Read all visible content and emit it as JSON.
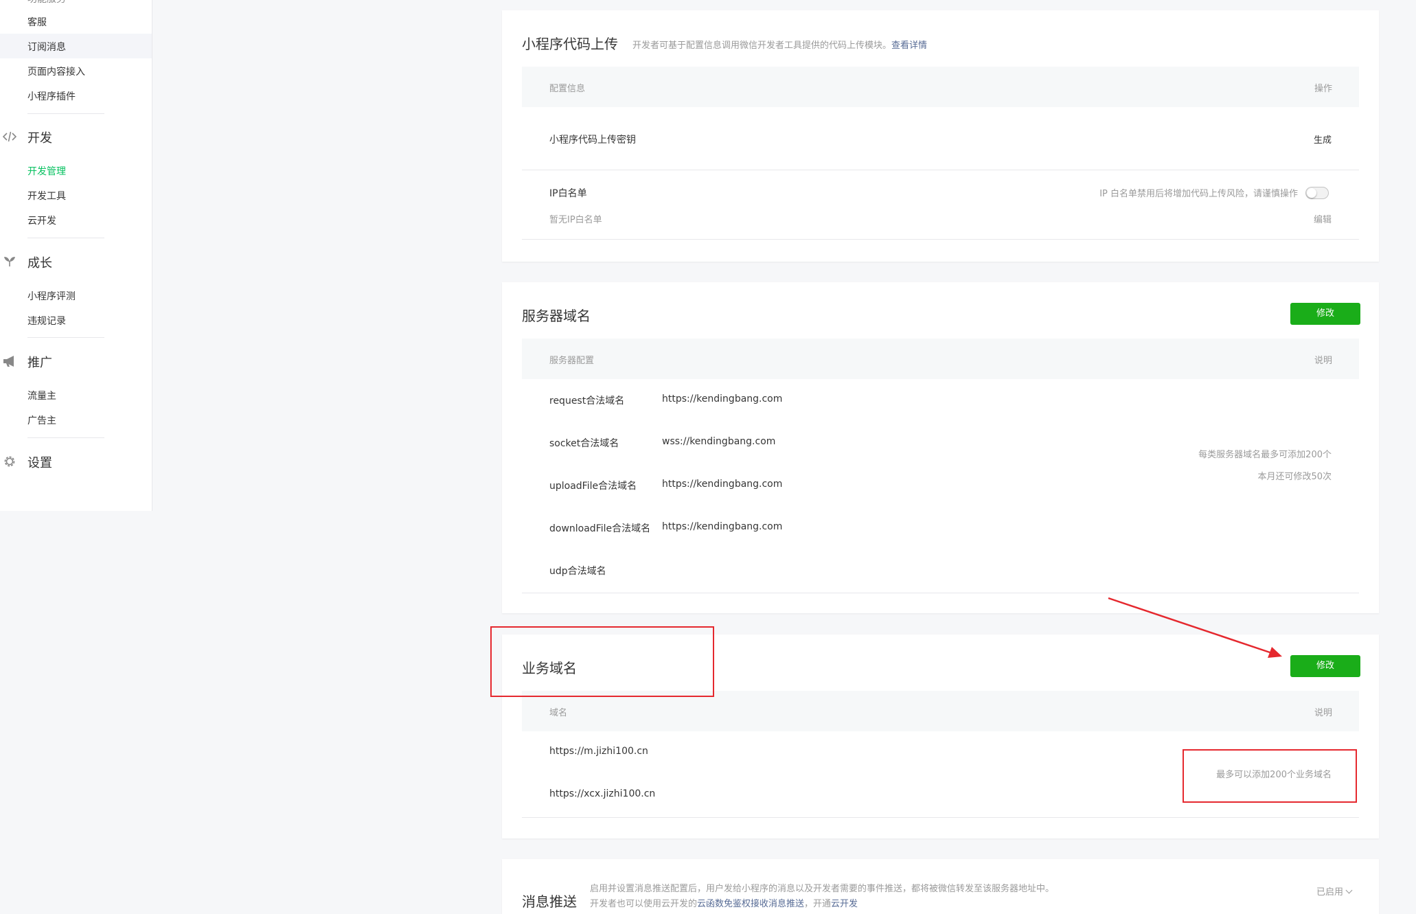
{
  "sidebar": {
    "cut_item": "功能服务",
    "items_top": [
      "客服",
      "订阅消息",
      "页面内容接入",
      "小程序插件"
    ],
    "dev": {
      "label": "开发",
      "items": [
        "开发管理",
        "开发工具",
        "云开发"
      ]
    },
    "growth": {
      "label": "成长",
      "items": [
        "小程序评测",
        "违规记录"
      ]
    },
    "promo": {
      "label": "推广",
      "items": [
        "流量主",
        "广告主"
      ]
    },
    "settings": {
      "label": "设置"
    }
  },
  "upload": {
    "title": "小程序代码上传",
    "desc": "开发者可基于配置信息调用微信开发者工具提供的代码上传模块。",
    "detail_link": "查看详情",
    "col_config": "配置信息",
    "col_action": "操作",
    "key_label": "小程序代码上传密钥",
    "key_action": "生成",
    "ip_label": "IP白名单",
    "ip_hint": "IP 白名单禁用后将增加代码上传风险，请谨慎操作",
    "ip_toggle_enabled": false,
    "ip_empty": "暂无IP白名单",
    "ip_edit": "编辑"
  },
  "server": {
    "title": "服务器域名",
    "modify": "修改",
    "col_config": "服务器配置",
    "col_note": "说明",
    "rows": [
      {
        "label": "request合法域名",
        "value": "https://kendingbang.com"
      },
      {
        "label": "socket合法域名",
        "value": "wss://kendingbang.com"
      },
      {
        "label": "uploadFile合法域名",
        "value": "https://kendingbang.com"
      },
      {
        "label": "downloadFile合法域名",
        "value": "https://kendingbang.com"
      },
      {
        "label": "udp合法域名",
        "value": ""
      }
    ],
    "note1": "每类服务器域名最多可添加200个",
    "note2": "本月还可修改50次"
  },
  "business": {
    "title": "业务域名",
    "modify": "修改",
    "col_domain": "域名",
    "col_note": "说明",
    "domains": [
      "https://m.jizhi100.cn",
      "https://xcx.jizhi100.cn"
    ],
    "note": "最多可以添加200个业务域名"
  },
  "push": {
    "title": "消息推送",
    "desc1": "启用并设置消息推送配置后，用户发给小程序的消息以及开发者需要的事件推送，都将被微信转发至该服务器地址中。",
    "desc2_a": "开发者也可以使用云开发的",
    "desc2_link": "云函数免鉴权接收消息推送",
    "desc2_b": "，开通",
    "desc2_link2": "云开发",
    "status": "已启用"
  },
  "colors": {
    "accent_green": "#1aad19",
    "nav_active": "#07c160",
    "link": "#576b95",
    "annotation_red": "#e5282e"
  }
}
